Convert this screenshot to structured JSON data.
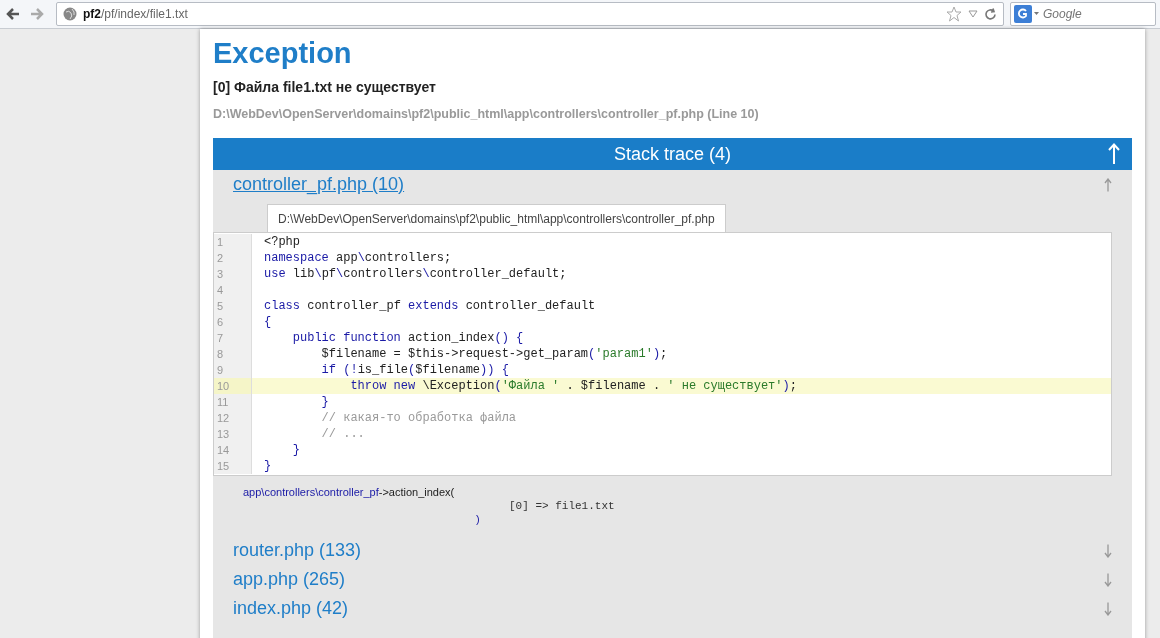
{
  "browser": {
    "url": "**pf2**/pf/index/file1.txt",
    "search": {
      "placeholder": "Google"
    }
  },
  "exception": {
    "title": "Exception",
    "message": "[0] Файла file1.txt не существует",
    "location": "D:\\WebDev\\OpenServer\\domains\\pf2\\public_html\\app\\controllers\\controller_pf.php (Line 10)"
  },
  "stack_trace": {
    "title": "Stack trace (4)",
    "expanded": true,
    "frames": [
      {
        "label": "controller_pf.php (10)",
        "expanded": true,
        "file_tab": "D:\\WebDev\\OpenServer\\domains\\pf2\\public_html\\app\\controllers\\controller_pf.php",
        "code": [
          {
            "number": "1",
            "highlighted": false,
            "tokens": [
              {
                "kind": "plain",
                "text": "<?php"
              }
            ]
          },
          {
            "number": "2",
            "highlighted": false,
            "tokens": [
              {
                "kind": "keyword",
                "text": "namespace"
              },
              {
                "kind": "plain",
                "text": " app"
              },
              {
                "kind": "keyword",
                "text": "\\"
              },
              {
                "kind": "plain",
                "text": "controllers;"
              }
            ]
          },
          {
            "number": "3",
            "highlighted": false,
            "tokens": [
              {
                "kind": "keyword",
                "text": "use"
              },
              {
                "kind": "plain",
                "text": " lib"
              },
              {
                "kind": "keyword",
                "text": "\\"
              },
              {
                "kind": "plain",
                "text": "pf"
              },
              {
                "kind": "keyword",
                "text": "\\"
              },
              {
                "kind": "plain",
                "text": "controllers"
              },
              {
                "kind": "keyword",
                "text": "\\"
              },
              {
                "kind": "plain",
                "text": "controller_default;"
              }
            ]
          },
          {
            "number": "4",
            "highlighted": false
          },
          {
            "number": "5",
            "highlighted": false,
            "tokens": [
              {
                "kind": "keyword",
                "text": "class"
              },
              {
                "kind": "plain",
                "text": " controller_pf "
              },
              {
                "kind": "keyword",
                "text": "extends"
              },
              {
                "kind": "plain",
                "text": " controller_default"
              }
            ]
          },
          {
            "number": "6",
            "highlighted": false,
            "tokens": [
              {
                "kind": "keyword",
                "text": "{"
              }
            ]
          },
          {
            "number": "7",
            "highlighted": false,
            "tokens": [
              {
                "kind": "keyword",
                "text": "    public function"
              },
              {
                "kind": "plain",
                "text": " action_index"
              },
              {
                "kind": "keyword",
                "text": "() {"
              }
            ]
          },
          {
            "number": "8",
            "highlighted": false,
            "tokens": [
              {
                "kind": "plain",
                "text": "        $filename = $this->request->get_param"
              },
              {
                "kind": "keyword",
                "text": "("
              },
              {
                "kind": "string",
                "text": "'param1'"
              },
              {
                "kind": "keyword",
                "text": ")"
              },
              {
                "kind": "plain",
                "text": ";"
              }
            ]
          },
          {
            "number": "9",
            "highlighted": false,
            "tokens": [
              {
                "kind": "keyword",
                "text": "        if (!"
              },
              {
                "kind": "plain",
                "text": "is_file"
              },
              {
                "kind": "keyword",
                "text": "("
              },
              {
                "kind": "plain",
                "text": "$filename"
              },
              {
                "kind": "keyword",
                "text": ")) {"
              }
            ]
          },
          {
            "number": "10",
            "highlighted": true,
            "tokens": [
              {
                "kind": "keyword",
                "text": "            throw new"
              },
              {
                "kind": "plain",
                "text": " \\Exception"
              },
              {
                "kind": "keyword",
                "text": "("
              },
              {
                "kind": "string",
                "text": "'Файла '"
              },
              {
                "kind": "plain",
                "text": " . $filename . "
              },
              {
                "kind": "string",
                "text": "' не существует'"
              },
              {
                "kind": "keyword",
                "text": ")"
              },
              {
                "kind": "plain",
                "text": ";"
              }
            ]
          },
          {
            "number": "11",
            "highlighted": false,
            "tokens": [
              {
                "kind": "keyword",
                "text": "        }"
              }
            ]
          },
          {
            "number": "12",
            "highlighted": false,
            "tokens": [
              {
                "kind": "comment",
                "text": "        // какая-то обработка файла"
              }
            ]
          },
          {
            "number": "13",
            "highlighted": false,
            "tokens": [
              {
                "kind": "comment",
                "text": "        // ..."
              }
            ]
          },
          {
            "number": "14",
            "highlighted": false,
            "tokens": [
              {
                "kind": "keyword",
                "text": "    }"
              }
            ]
          },
          {
            "number": "15",
            "highlighted": false,
            "tokens": [
              {
                "kind": "keyword",
                "text": "}"
              }
            ]
          }
        ],
        "call": {
          "class": "app\\controllers\\controller_pf",
          "method": "->action_index(",
          "args": "[0] => file1.txt",
          "close": ")"
        }
      },
      {
        "label": "router.php (133)",
        "expanded": false
      },
      {
        "label": "app.php (265)",
        "expanded": false
      },
      {
        "label": "index.php (42)",
        "expanded": false
      }
    ]
  }
}
